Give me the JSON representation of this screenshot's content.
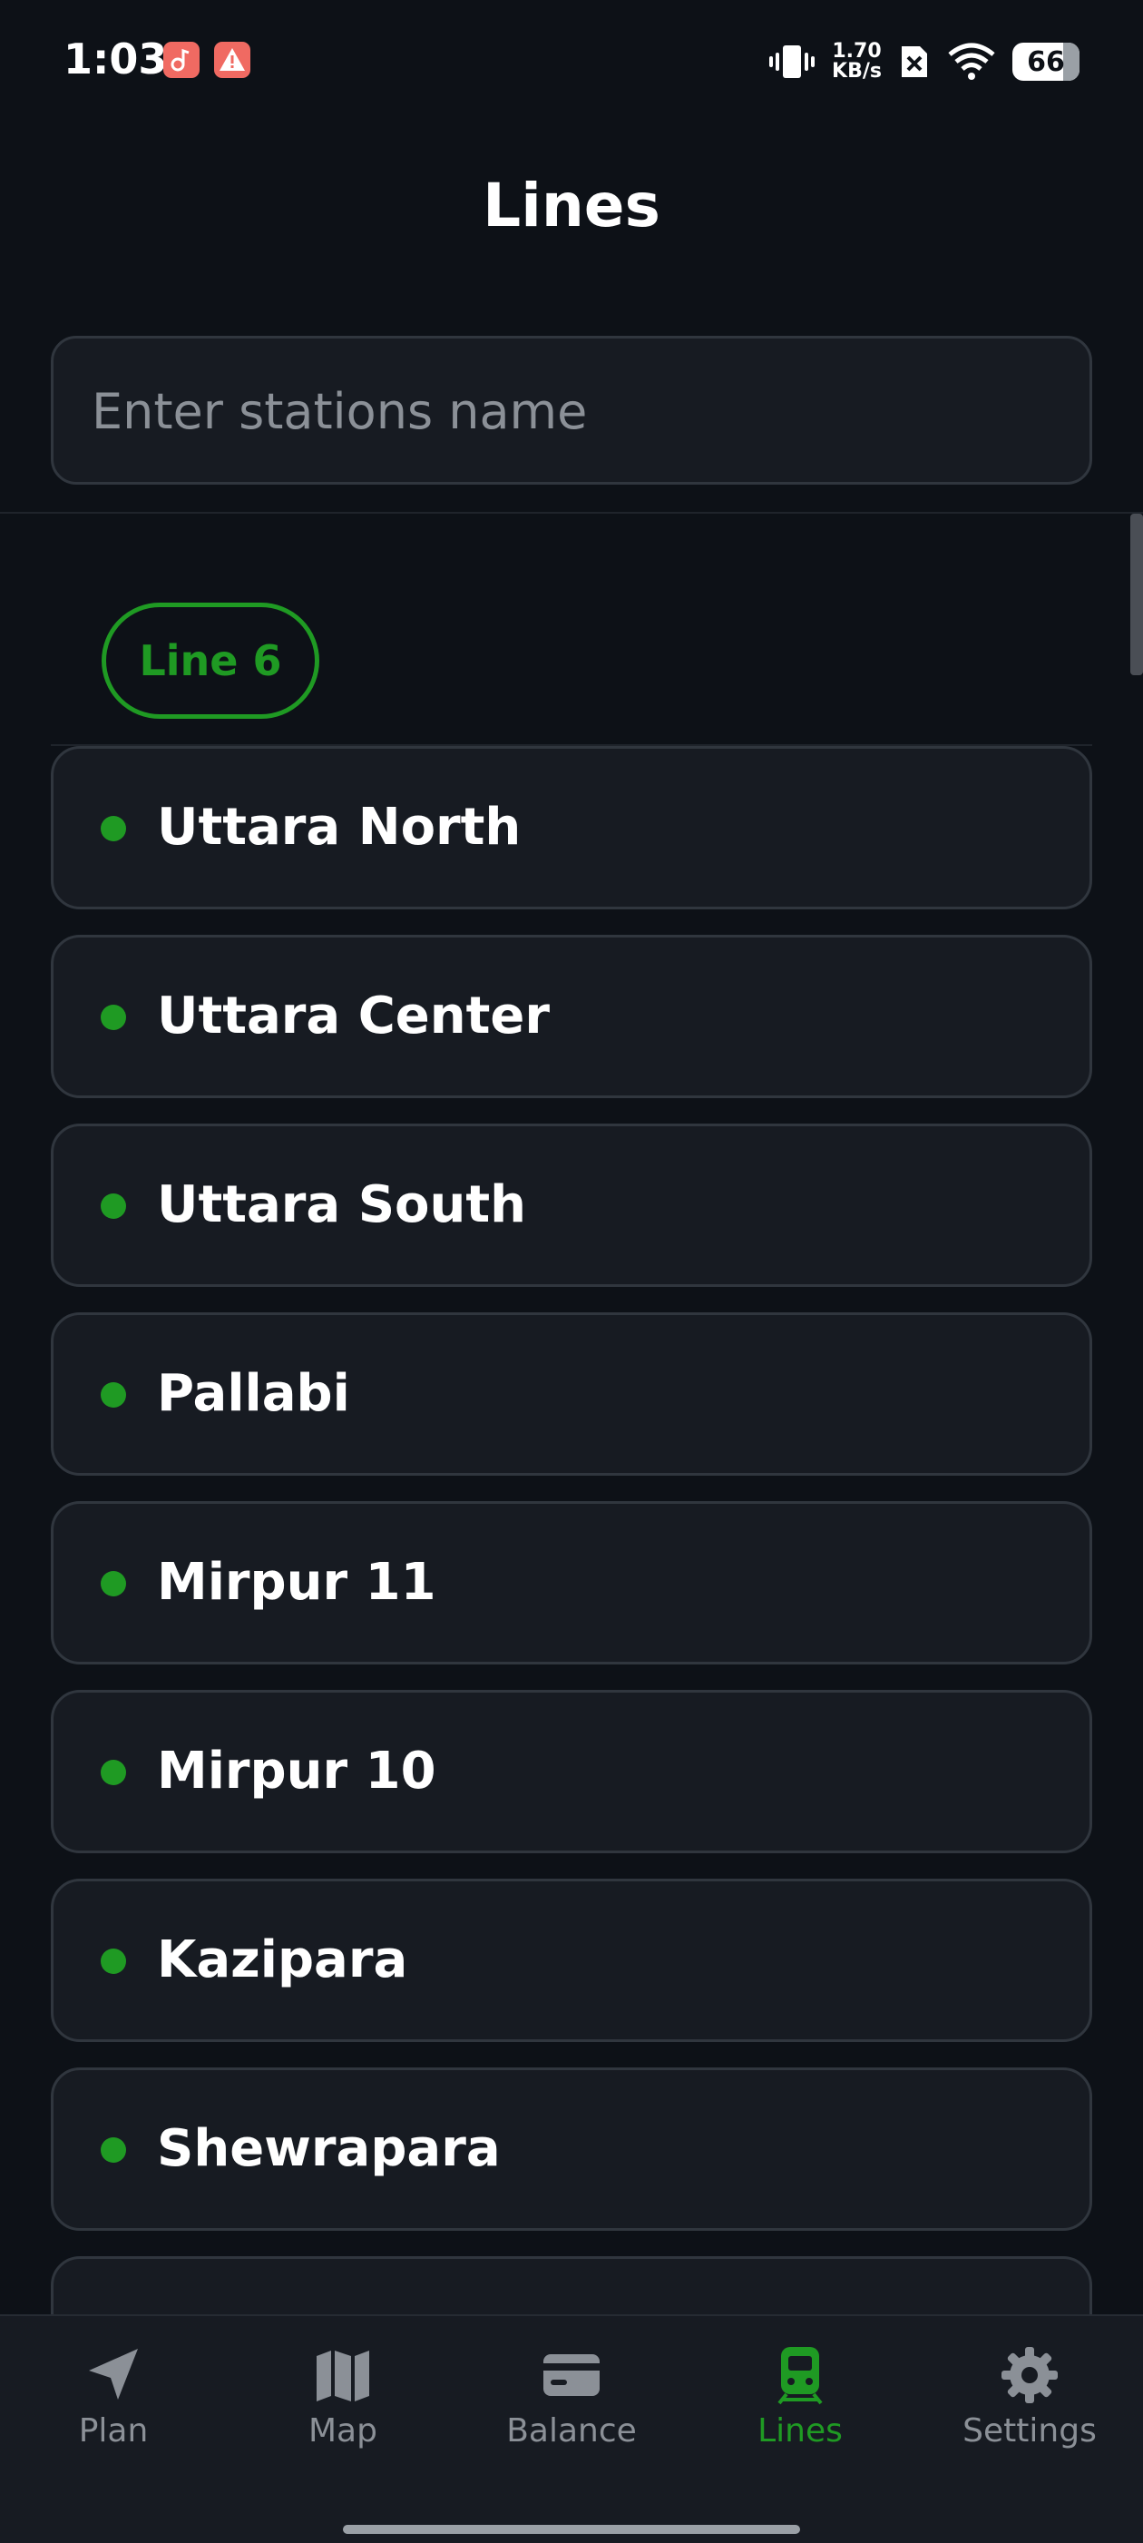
{
  "status_bar": {
    "time": "1:03",
    "net_speed_value": "1.70",
    "net_speed_unit": "KB/s",
    "battery_level": "66",
    "icons": [
      "music-app-icon",
      "alert-icon",
      "vibrate-icon",
      "no-sim-icon",
      "wifi-icon",
      "battery-icon"
    ]
  },
  "header": {
    "title": "Lines"
  },
  "search": {
    "placeholder": "Enter stations name",
    "value": ""
  },
  "line_filter": {
    "label": "Line 6",
    "color": "#1f9a23"
  },
  "stations": [
    {
      "name": "Uttara North"
    },
    {
      "name": "Uttara Center"
    },
    {
      "name": "Uttara South"
    },
    {
      "name": "Pallabi"
    },
    {
      "name": "Mirpur 11"
    },
    {
      "name": "Mirpur 10"
    },
    {
      "name": "Kazipara"
    },
    {
      "name": "Shewrapara"
    }
  ],
  "bottom_nav": {
    "items": [
      {
        "label": "Plan",
        "icon": "navigation-arrow-icon"
      },
      {
        "label": "Map",
        "icon": "map-icon"
      },
      {
        "label": "Balance",
        "icon": "card-icon"
      },
      {
        "label": "Lines",
        "icon": "train-icon",
        "active": true
      },
      {
        "label": "Settings",
        "icon": "gear-icon"
      }
    ]
  },
  "colors": {
    "background": "#0d1117",
    "card": "#171b22",
    "accent": "#1f9a23",
    "muted": "#8b9097"
  }
}
